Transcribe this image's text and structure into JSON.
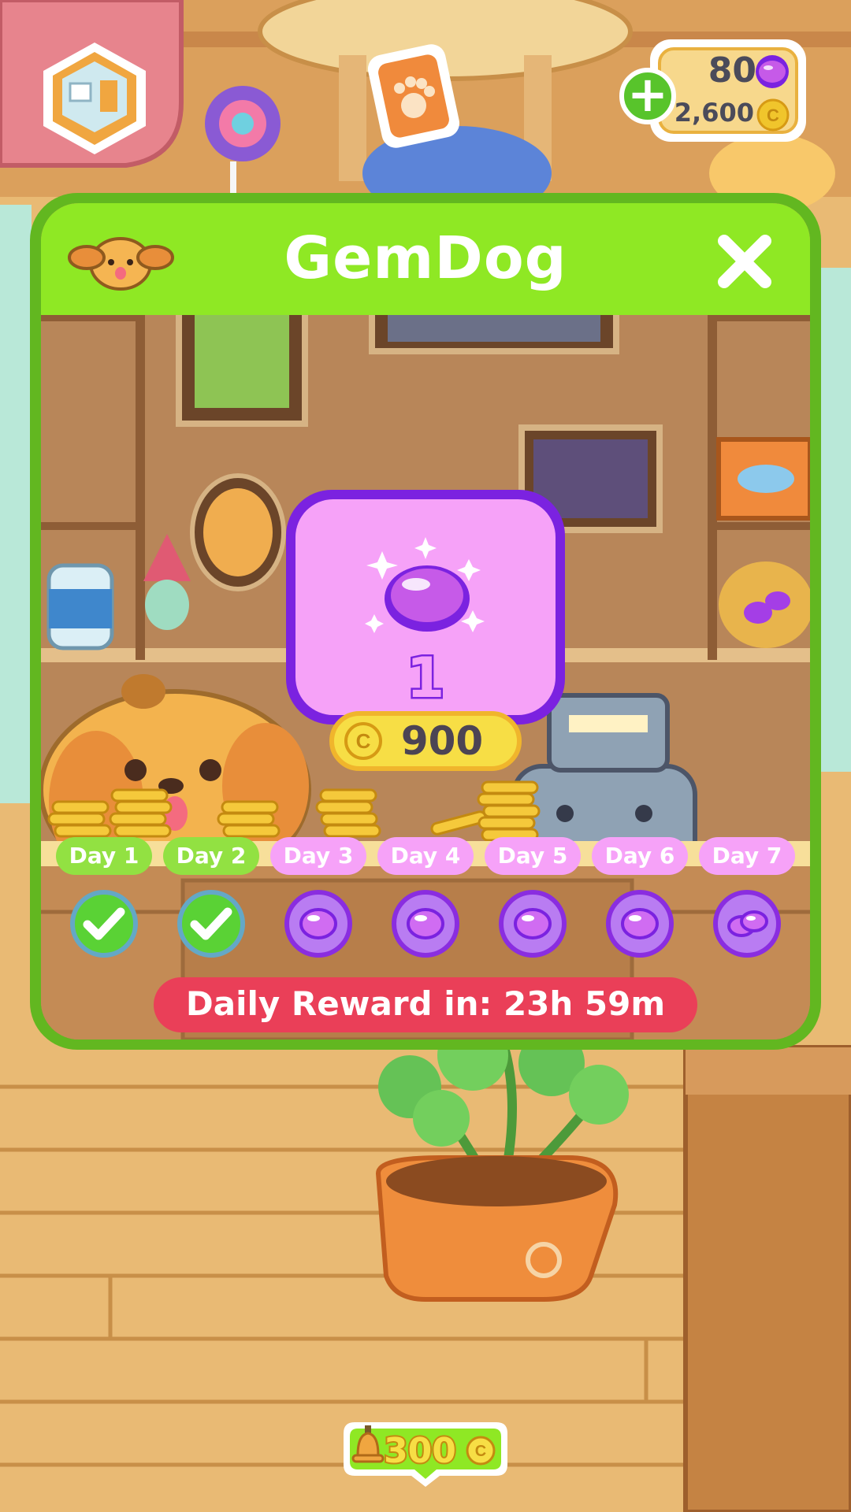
{
  "hud": {
    "gems": "80",
    "coins": "2,600",
    "plus_label": "+",
    "colors": {
      "gem": "#c65ae8",
      "coin": "#f0c52c",
      "plus": "#58c42b"
    }
  },
  "modal": {
    "title": "GemDog",
    "close_label": "✕",
    "reward": {
      "amount": "1",
      "price": "900"
    },
    "days": [
      {
        "label": "Day 1",
        "status": "claimed"
      },
      {
        "label": "Day 2",
        "status": "claimed"
      },
      {
        "label": "Day 3",
        "status": "gem"
      },
      {
        "label": "Day 4",
        "status": "gem"
      },
      {
        "label": "Day 5",
        "status": "gem"
      },
      {
        "label": "Day 6",
        "status": "gem"
      },
      {
        "label": "Day 7",
        "status": "gems"
      }
    ],
    "timer_text": "Daily Reward in: 23h 59m",
    "colors": {
      "frame": "#62b720",
      "header": "#8fe824",
      "card": "#f6a2f8",
      "card_border": "#7b22e0",
      "timer": "#ea3f58"
    }
  },
  "bottom": {
    "coins": "300"
  }
}
